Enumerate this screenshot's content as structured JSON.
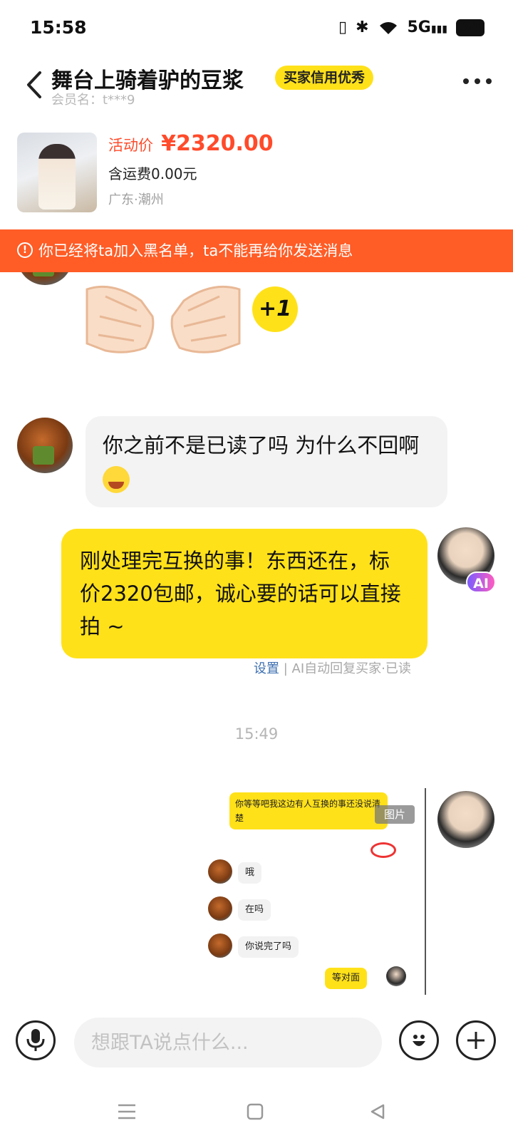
{
  "status_bar": {
    "time": "15:58",
    "battery": "54",
    "network": "5G"
  },
  "header": {
    "seller_name": "舞台上骑着驴的豆浆",
    "credit_badge": "买家信用优秀",
    "member_name": "会员名：t***9"
  },
  "product": {
    "price_label": "活动价",
    "price_value": "¥2320.00",
    "shipping": "含运费0.00元",
    "location": "广东·潮州"
  },
  "banner": {
    "text": "你已经将ta加入黑名单，ta不能再给你发送消息"
  },
  "messages": {
    "plus_one": "+1",
    "buyer_msg_1": "你之前不是已读了吗 为什么不回啊",
    "seller_msg_1": "刚处理完互换的事！东西还在，标价2320包邮，诚心要的话可以直接拍 ~",
    "ai_badge": "AI",
    "status_link": "设置",
    "status_rest": " | AI自动回复买家·已读",
    "timestamp": "15:49"
  },
  "screenshot_msg": {
    "yellow_text": "你等等吧我这边有人互换的事还没说清楚",
    "tag": "图片",
    "msg_1": "哦",
    "msg_2": "在吗",
    "msg_3": "你说完了吗",
    "msg_4": "等对面"
  },
  "input": {
    "placeholder": "想跟TA说点什么..."
  },
  "colors": {
    "accent_yellow": "#ffe11a",
    "price_red": "#ff4b2b",
    "banner_orange": "#ff5c26"
  }
}
